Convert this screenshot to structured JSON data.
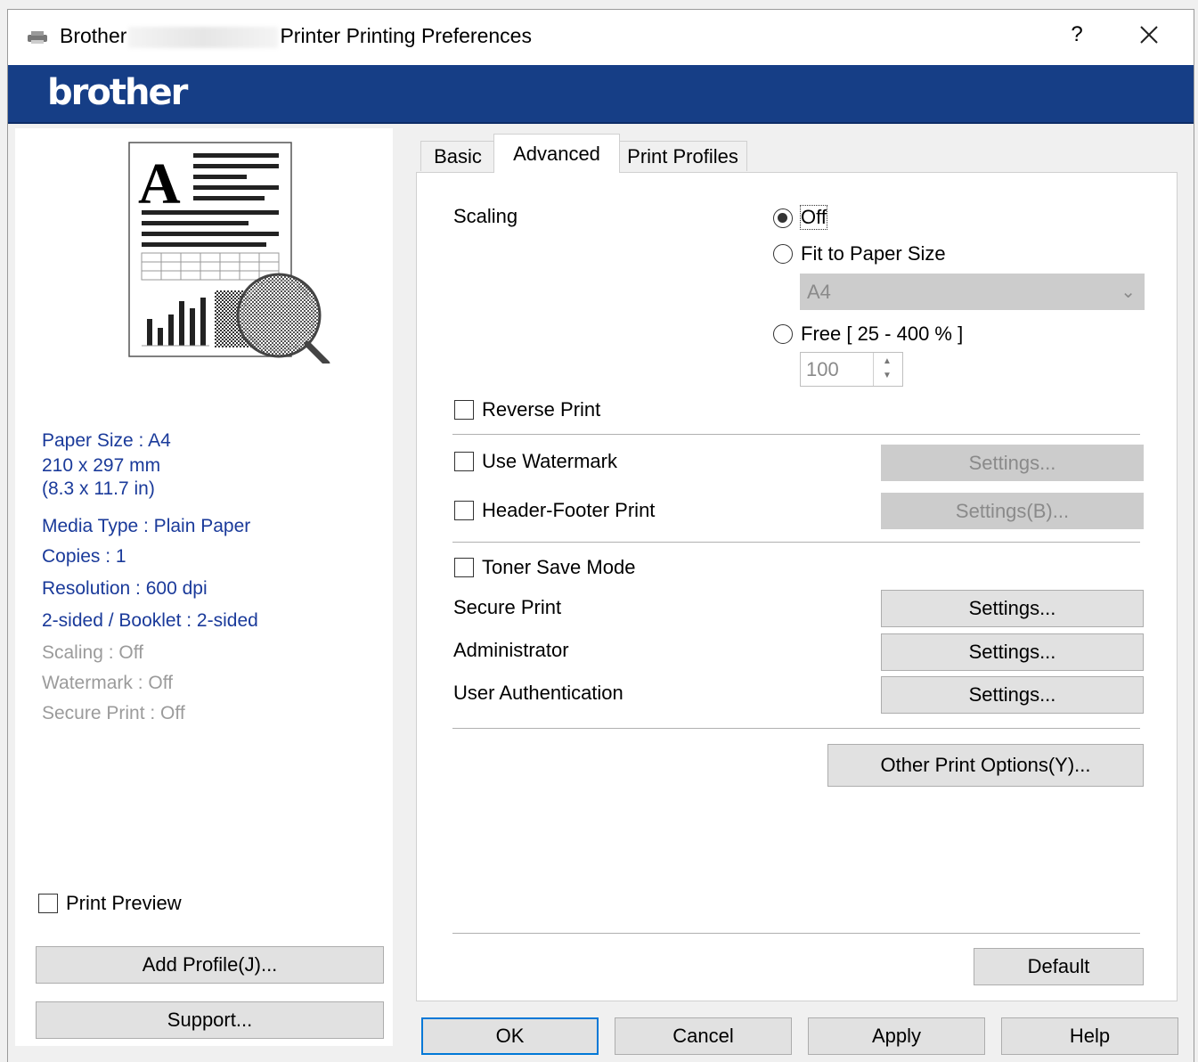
{
  "window": {
    "title_prefix": "Brother",
    "title_suffix": "Printer Printing Preferences",
    "help_label": "?",
    "logo": "brother"
  },
  "summary": {
    "paper_size": "Paper Size : A4",
    "paper_mm": "210 x 297 mm",
    "paper_in": "(8.3 x 11.7 in)",
    "media_type": "Media Type : Plain Paper",
    "copies": "Copies : 1",
    "resolution": "Resolution : 600 dpi",
    "two_sided": "2-sided / Booklet : 2-sided",
    "scaling": "Scaling : Off",
    "watermark": "Watermark : Off",
    "secure_print": "Secure Print : Off"
  },
  "left": {
    "print_preview": {
      "label": "Print Preview",
      "checked": false
    },
    "add_profile": "Add Profile(J)...",
    "support": "Support..."
  },
  "tabs": [
    {
      "label": "Basic",
      "active": false
    },
    {
      "label": "Advanced",
      "active": true
    },
    {
      "label": "Print Profiles",
      "active": false
    }
  ],
  "advanced": {
    "scaling_label": "Scaling",
    "scaling_options": [
      {
        "label": "Off",
        "selected": true
      },
      {
        "label": "Fit to Paper Size",
        "selected": false
      },
      {
        "label": "Free [ 25 - 400 % ]",
        "selected": false
      }
    ],
    "fit_paper_value": "A4",
    "free_value": "100",
    "reverse_print": {
      "label": "Reverse Print",
      "checked": false
    },
    "use_watermark": {
      "label": "Use Watermark",
      "checked": false,
      "settings": "Settings..."
    },
    "header_footer": {
      "label": "Header-Footer Print",
      "checked": false,
      "settings": "Settings(B)..."
    },
    "toner_save": {
      "label": "Toner Save Mode",
      "checked": false
    },
    "secure_print": {
      "label": "Secure Print",
      "settings": "Settings..."
    },
    "administrator": {
      "label": "Administrator",
      "settings": "Settings..."
    },
    "user_auth": {
      "label": "User Authentication",
      "settings": "Settings..."
    },
    "other_options": "Other Print Options(Y)...",
    "default": "Default"
  },
  "footer": {
    "ok": "OK",
    "cancel": "Cancel",
    "apply": "Apply",
    "help": "Help"
  }
}
